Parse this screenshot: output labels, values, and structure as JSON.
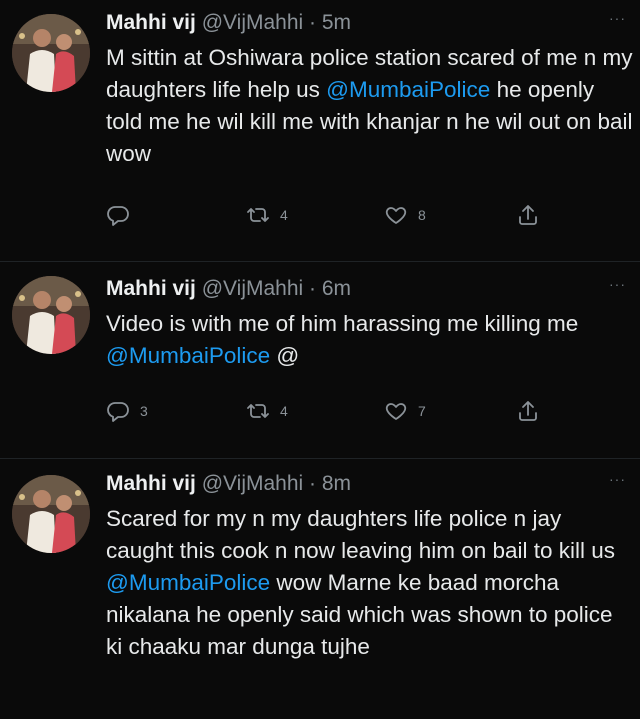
{
  "tweets": [
    {
      "name": "Mahhi vij",
      "handle": "@VijMahhi",
      "dot": "·",
      "time": "5m",
      "more": "···",
      "text_parts": [
        "M sittin at Oshiwara police station scared of me n my daughters life help us ",
        "@MumbaiPolice",
        " he openly told me he wil kill me with khanjar n he wil out on bail wow"
      ],
      "reply_count": "",
      "retweet_count": "4",
      "like_count": "8",
      "reply_icon": "reply-icon",
      "retweet_icon": "retweet-icon",
      "like_icon": "heart-icon",
      "share_icon": "share-icon"
    },
    {
      "name": "Mahhi vij",
      "handle": "@VijMahhi",
      "dot": "·",
      "time": "6m",
      "more": "···",
      "text_parts": [
        "Video is with me of him harassing me killing me ",
        "@MumbaiPolice",
        " @"
      ],
      "reply_count": "3",
      "retweet_count": "4",
      "like_count": "7",
      "reply_icon": "reply-icon",
      "retweet_icon": "retweet-icon",
      "like_icon": "heart-icon",
      "share_icon": "share-icon"
    },
    {
      "name": "Mahhi vij",
      "handle": "@VijMahhi",
      "dot": "·",
      "time": "8m",
      "more": "···",
      "text_parts": [
        "Scared for my n my daughters life police n jay caught this cook n now leaving him on bail to kill us ",
        "@MumbaiPolice",
        " wow Marne ke baad morcha nikalana he openly said which was shown to police ki chaaku mar dunga tujhe"
      ]
    }
  ],
  "colors": {
    "background": "#0a0a0a",
    "text": "#e7e9ea",
    "secondary": "#8b9298",
    "mention": "#1d9bf0"
  }
}
